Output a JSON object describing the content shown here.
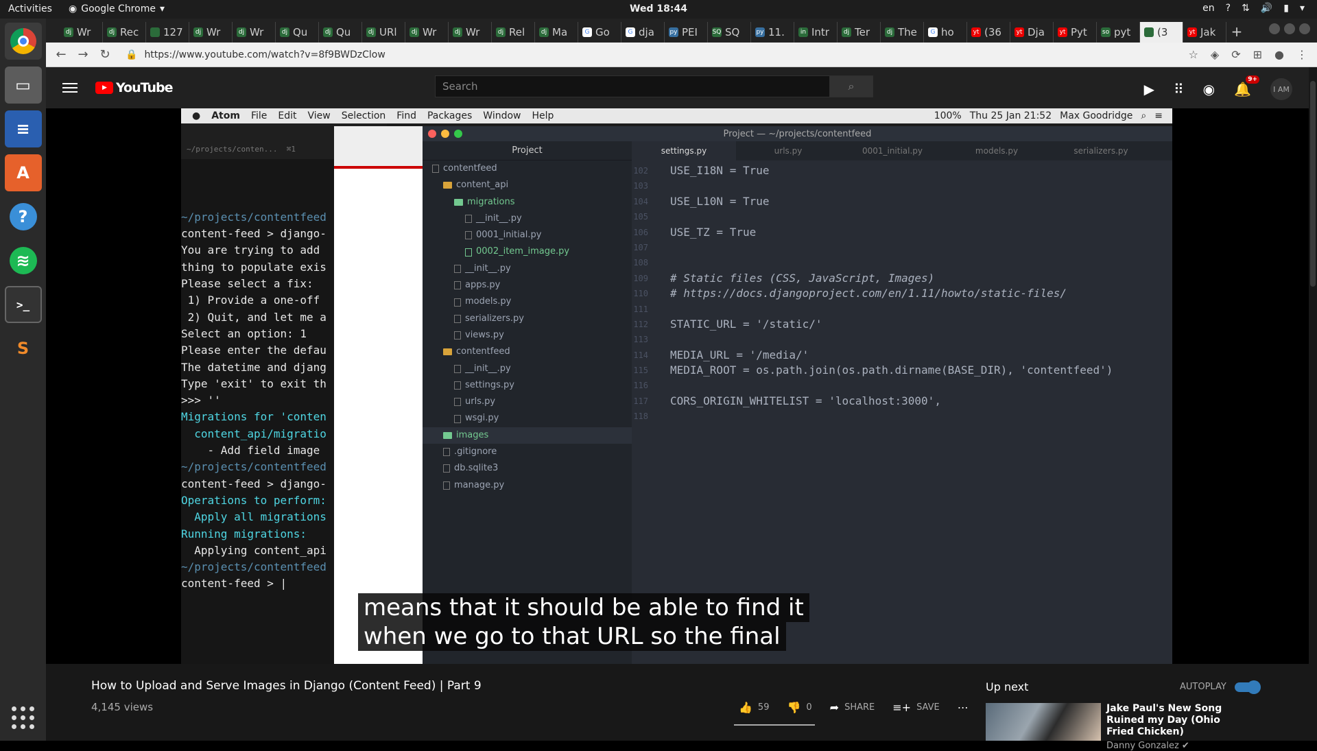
{
  "topbar": {
    "activities": "Activities",
    "app": "Google Chrome",
    "clock": "Wed 18:44",
    "lang": "en"
  },
  "dock": [
    "chrome",
    "files",
    "writer",
    "software",
    "help",
    "spotify",
    "terminal",
    "sublime"
  ],
  "tabs": [
    {
      "icon": "dj",
      "label": "Wr"
    },
    {
      "icon": "dj",
      "label": "Rec"
    },
    {
      "icon": "",
      "label": "127"
    },
    {
      "icon": "dj",
      "label": "Wr"
    },
    {
      "icon": "dj",
      "label": "Wr"
    },
    {
      "icon": "dj",
      "label": "Qu"
    },
    {
      "icon": "dj",
      "label": "Qu"
    },
    {
      "icon": "dj",
      "label": "URl"
    },
    {
      "icon": "dj",
      "label": "Wr"
    },
    {
      "icon": "dj",
      "label": "Wr"
    },
    {
      "icon": "dj",
      "label": "Rel"
    },
    {
      "icon": "dj",
      "label": "Ma"
    },
    {
      "icon": "G",
      "label": "Go"
    },
    {
      "icon": "G",
      "label": "dja"
    },
    {
      "icon": "py",
      "label": "PEI"
    },
    {
      "icon": "SQ",
      "label": "SQ"
    },
    {
      "icon": "py",
      "label": "11."
    },
    {
      "icon": "in",
      "label": "Intr"
    },
    {
      "icon": "dj",
      "label": "Ter"
    },
    {
      "icon": "dj",
      "label": "The"
    },
    {
      "icon": "G",
      "label": "ho"
    },
    {
      "icon": "yt",
      "label": "(36"
    },
    {
      "icon": "yt",
      "label": "Dja"
    },
    {
      "icon": "yt",
      "label": "Pyt"
    },
    {
      "icon": "so",
      "label": "pyt"
    },
    {
      "icon": "",
      "label": "(3"
    },
    {
      "icon": "yt",
      "label": "Jak"
    }
  ],
  "address": {
    "url": "https://www.youtube.com/watch?v=8f9BWDzClow"
  },
  "youtube": {
    "logo": "YouTube",
    "search_placeholder": "Search",
    "notif_count": "9+",
    "avatar": "I AM"
  },
  "mac": {
    "menu": [
      "Atom",
      "File",
      "Edit",
      "View",
      "Selection",
      "Find",
      "Packages",
      "Window",
      "Help"
    ],
    "battery": "100%",
    "datetime": "Thu 25 Jan  21:52",
    "user": "Max Goodridge"
  },
  "terminal": {
    "tab": "~/projects/conten...  ⌘1",
    "lines": [
      "~/projects/contentfeed",
      "content-feed > django-",
      "You are trying to add",
      "thing to populate exis",
      "Please select a fix:",
      " 1) Provide a one-off",
      " 2) Quit, and let me a",
      "Select an option: 1",
      "Please enter the defau",
      "The datetime and djang",
      "Type 'exit' to exit th",
      ">>> ''",
      "Migrations for 'conten",
      "  content_api/migratio",
      "    - Add field image",
      "",
      "~/projects/contentfeed",
      "content-feed > django-",
      "Operations to perform:",
      "  Apply all migrations",
      "Running migrations:",
      "  Applying content_api",
      "",
      "~/projects/contentfeed",
      "content-feed > |"
    ]
  },
  "atom": {
    "title": "Project — ~/projects/contentfeed",
    "project_label": "Project",
    "tree": [
      {
        "d": 0,
        "t": "contentfeed",
        "k": "root"
      },
      {
        "d": 1,
        "t": "content_api",
        "k": "folder"
      },
      {
        "d": 2,
        "t": "migrations",
        "k": "folder-g"
      },
      {
        "d": 3,
        "t": "__init__.py",
        "k": "file"
      },
      {
        "d": 3,
        "t": "0001_initial.py",
        "k": "file"
      },
      {
        "d": 3,
        "t": "0002_item_image.py",
        "k": "file-g"
      },
      {
        "d": 2,
        "t": "__init__.py",
        "k": "file"
      },
      {
        "d": 2,
        "t": "apps.py",
        "k": "file"
      },
      {
        "d": 2,
        "t": "models.py",
        "k": "file"
      },
      {
        "d": 2,
        "t": "serializers.py",
        "k": "file"
      },
      {
        "d": 2,
        "t": "views.py",
        "k": "file"
      },
      {
        "d": 1,
        "t": "contentfeed",
        "k": "folder"
      },
      {
        "d": 2,
        "t": "__init__.py",
        "k": "file"
      },
      {
        "d": 2,
        "t": "settings.py",
        "k": "file"
      },
      {
        "d": 2,
        "t": "urls.py",
        "k": "file"
      },
      {
        "d": 2,
        "t": "wsgi.py",
        "k": "file"
      },
      {
        "d": 1,
        "t": "images",
        "k": "folder-g"
      },
      {
        "d": 1,
        "t": ".gitignore",
        "k": "file"
      },
      {
        "d": 1,
        "t": "db.sqlite3",
        "k": "file"
      },
      {
        "d": 1,
        "t": "manage.py",
        "k": "file"
      }
    ],
    "editor_tabs": [
      "settings.py",
      "urls.py",
      "0001_initial.py",
      "models.py",
      "serializers.py"
    ],
    "code": [
      {
        "n": "102",
        "c": "USE_I18N = True"
      },
      {
        "n": "103",
        "c": ""
      },
      {
        "n": "104",
        "c": "USE_L10N = True"
      },
      {
        "n": "105",
        "c": ""
      },
      {
        "n": "106",
        "c": "USE_TZ = True"
      },
      {
        "n": "107",
        "c": ""
      },
      {
        "n": "108",
        "c": ""
      },
      {
        "n": "109",
        "c": "# Static files (CSS, JavaScript, Images)"
      },
      {
        "n": "110",
        "c": "# https://docs.djangoproject.com/en/1.11/howto/static-files/"
      },
      {
        "n": "111",
        "c": ""
      },
      {
        "n": "112",
        "c": "STATIC_URL = '/static/'"
      },
      {
        "n": "113",
        "c": ""
      },
      {
        "n": "114",
        "c": "MEDIA_URL = '/media/'"
      },
      {
        "n": "115",
        "c": "MEDIA_ROOT = os.path.join(os.path.dirname(BASE_DIR), 'contentfeed')"
      },
      {
        "n": "116",
        "c": ""
      },
      {
        "n": "117",
        "c": "CORS_ORIGIN_WHITELIST = 'localhost:3000',"
      },
      {
        "n": "118",
        "c": ""
      }
    ]
  },
  "caption": {
    "line1": "means that it should be able to find it",
    "line2": "when we go to that URL so the final"
  },
  "video": {
    "title": "How to Upload and Serve Images in Django (Content Feed) | Part 9",
    "views": "4,145 views",
    "likes": "59",
    "dislikes": "0",
    "share": "SHARE",
    "save": "SAVE"
  },
  "sidebar": {
    "upnext": "Up next",
    "autoplay": "AUTOPLAY",
    "next_title": "Jake Paul's New Song Ruined my Day (Ohio Fried Chicken)",
    "next_channel": "Danny Gonzalez ✔"
  }
}
